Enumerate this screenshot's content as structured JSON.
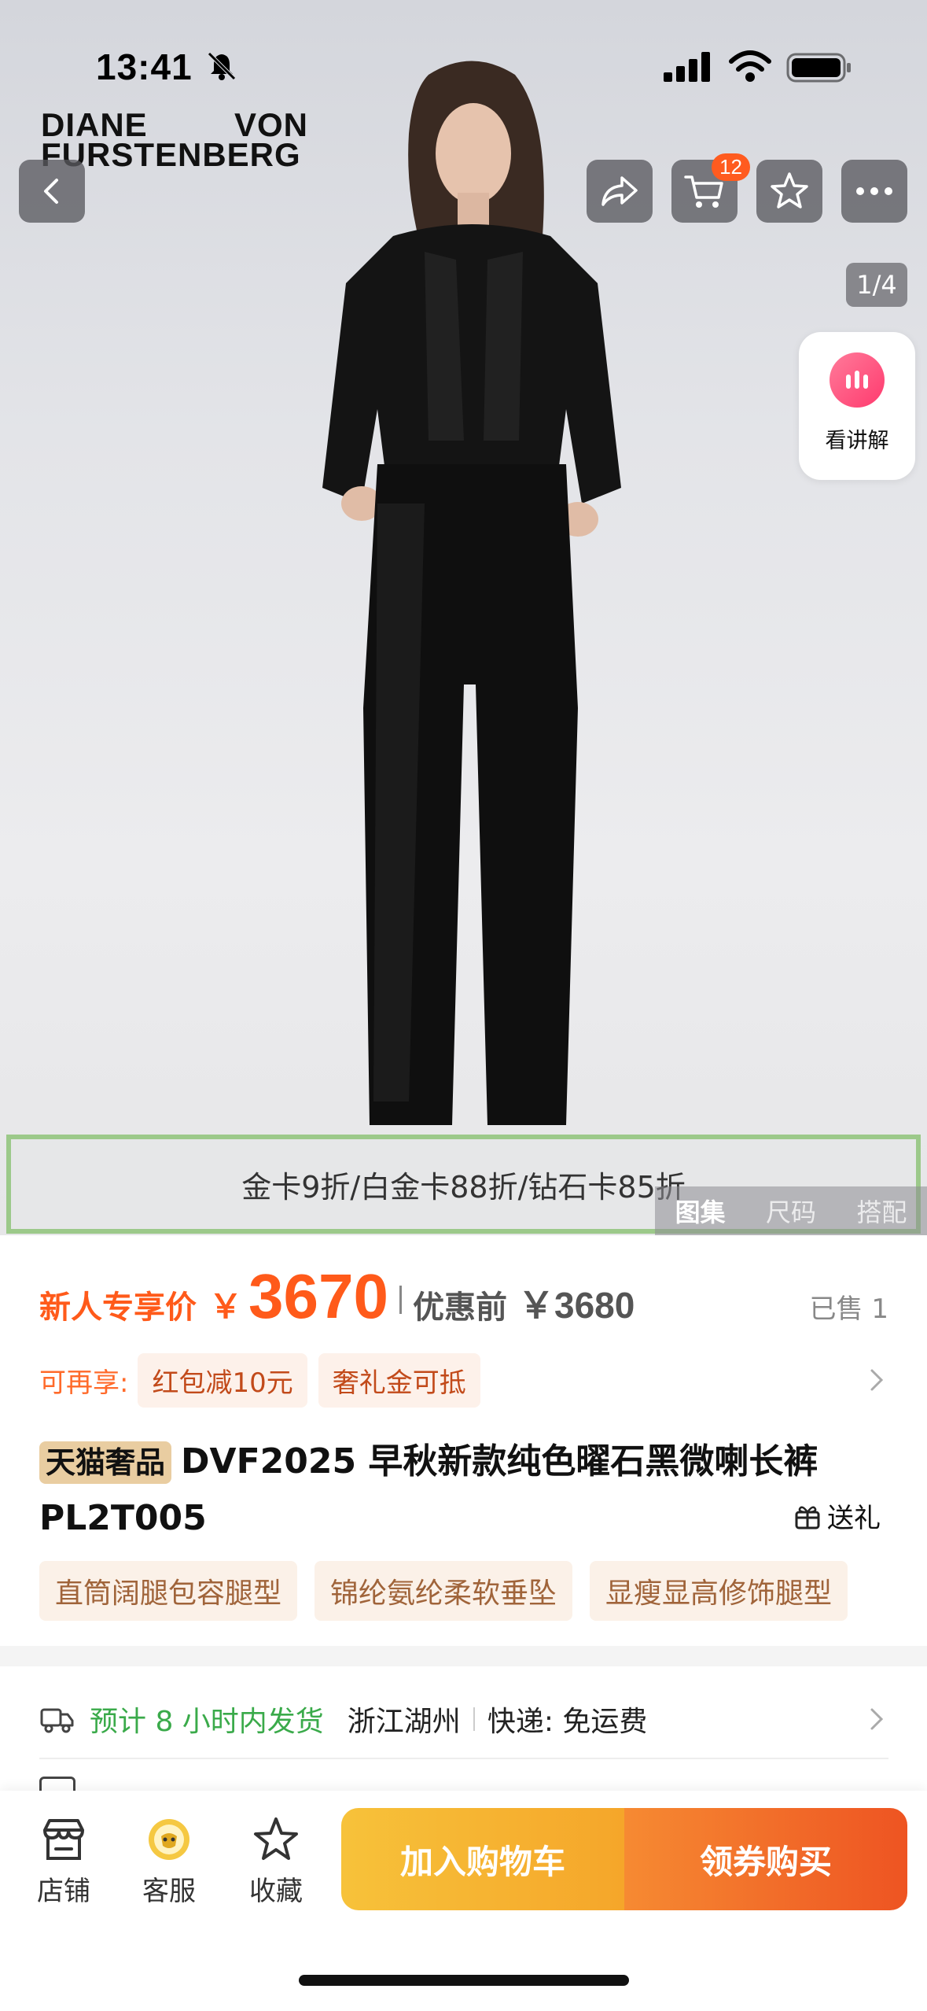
{
  "status": {
    "time": "13:41"
  },
  "brand": {
    "line1_a": "DIANE",
    "line1_b": "VON",
    "line2": "FURSTENBERG"
  },
  "header": {
    "cart_count": "12",
    "image_counter": "1/4",
    "live_label": "看讲解"
  },
  "promo": {
    "text": "金卡9折/白金卡88折/钻石卡85折"
  },
  "gallery_tabs": [
    "图集",
    "尺码",
    "搭配"
  ],
  "price": {
    "label": "新人专享价",
    "currency": "￥",
    "amount": "3670",
    "orig_label": "优惠前",
    "orig_amount": "￥3680",
    "sold": "已售 1"
  },
  "benefits": {
    "label": "可再享:",
    "chips": [
      "红包减10元",
      "奢礼金可抵"
    ]
  },
  "product": {
    "store_tag": "天猫奢品",
    "title": "DVF2025 早秋新款纯色曜石黑微喇长裤",
    "title_line2": "PL2T005",
    "gift_label": "送礼"
  },
  "features": [
    "直筒阔腿包容腿型",
    "锦纶氨纶柔软垂坠",
    "显瘦显高修饰腿型"
  ],
  "shipping": {
    "eta": "预计 8 小时内发货",
    "city": "浙江湖州",
    "fee": "快递: 免运费"
  },
  "bottom_nav": {
    "store": "店铺",
    "service": "客服",
    "favorite": "收藏",
    "add_cart": "加入购物车",
    "buy": "领券购买"
  },
  "colors": {
    "accent": "#ff5a1a",
    "green": "#3aaa4a",
    "gold": "#f7c23a"
  }
}
